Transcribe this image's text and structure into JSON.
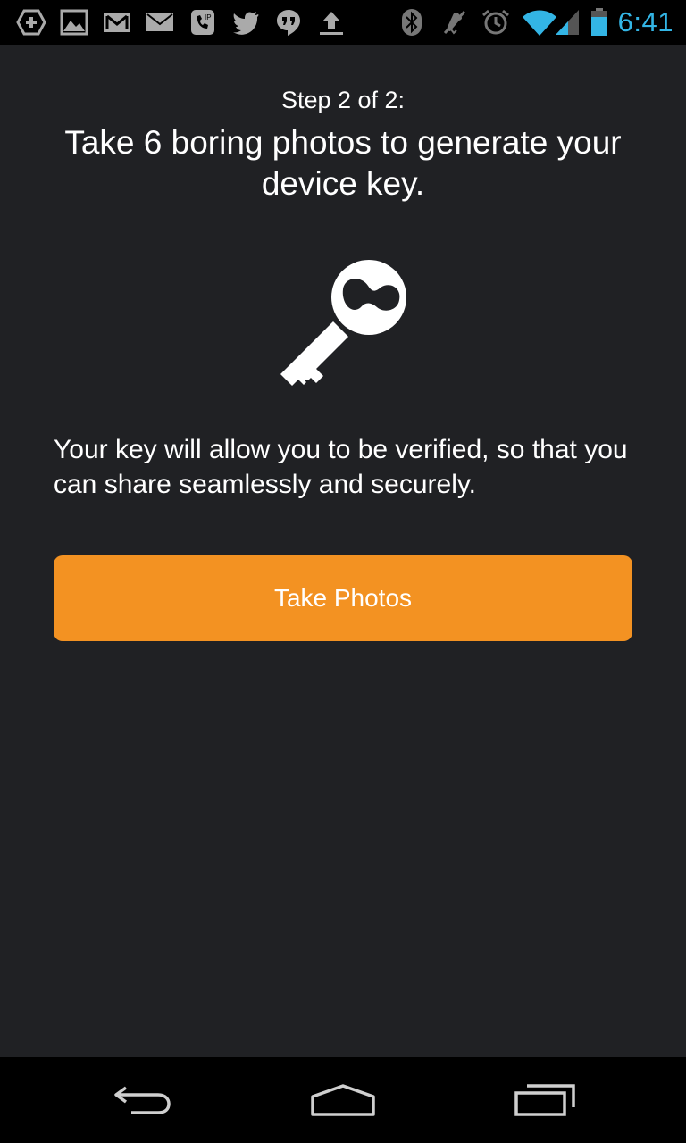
{
  "status_bar": {
    "time": "6:41",
    "notification_icons": [
      "add-icon",
      "gallery-icon",
      "gmail-icon",
      "email-icon",
      "voip-icon",
      "twitter-icon",
      "hangouts-icon",
      "upload-icon"
    ],
    "system_icons": [
      "bluetooth-icon",
      "mute-icon",
      "alarm-icon",
      "wifi-icon",
      "signal-icon",
      "battery-icon"
    ],
    "accent_color": "#33b5e5"
  },
  "content": {
    "step_label": "Step 2 of 2:",
    "headline": "Take 6 boring photos to generate your device key.",
    "icon": "key-icon",
    "description": "Your key will allow you to be verified, so that you can share seamlessly and securely.",
    "button_label": "Take Photos",
    "button_color": "#f39222",
    "background_color": "#202124"
  },
  "nav_bar": {
    "buttons": [
      "back-icon",
      "home-icon",
      "recent-apps-icon"
    ]
  }
}
